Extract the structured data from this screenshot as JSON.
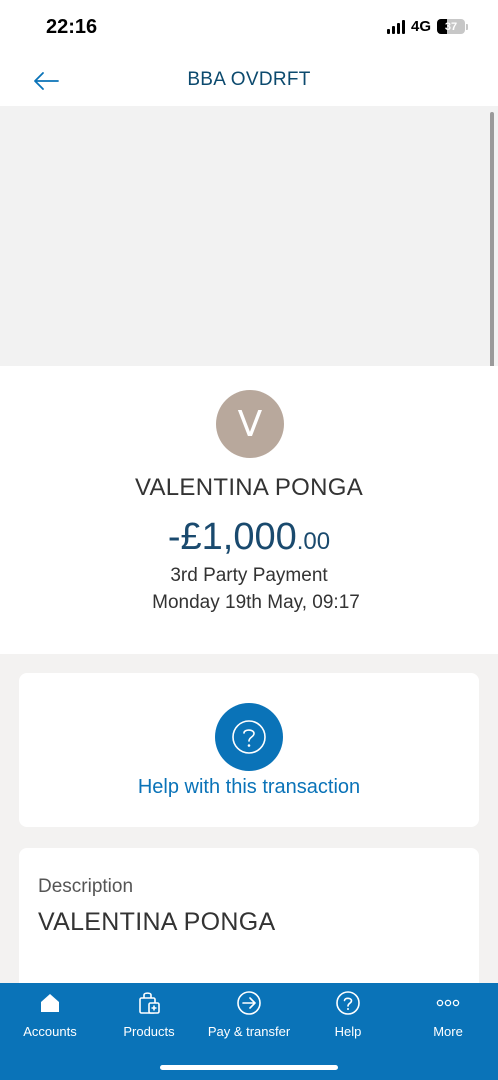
{
  "status_bar": {
    "time": "22:16",
    "network": "4G",
    "battery": "37",
    "battery_level": 0.37
  },
  "header": {
    "title": "BBA OVDRFT",
    "back_icon": "arrow-left-icon"
  },
  "transaction": {
    "avatar_initial": "V",
    "payee": "VALENTINA PONGA",
    "amount_main": "-£1,000",
    "amount_pence": ".00",
    "type": "3rd Party Payment",
    "date": "Monday 19th May, 09:17"
  },
  "help": {
    "icon": "question-circle-icon",
    "label": "Help with this transaction"
  },
  "description": {
    "label": "Description",
    "value": "VALENTINA PONGA"
  },
  "bottom_nav": {
    "items": [
      {
        "label": "Accounts",
        "icon": "home-icon"
      },
      {
        "label": "Products",
        "icon": "shopping-bag-icon"
      },
      {
        "label": "Pay & transfer",
        "icon": "arrow-circle-icon"
      },
      {
        "label": "Help",
        "icon": "question-circle-icon"
      },
      {
        "label": "More",
        "icon": "more-dots-icon"
      }
    ]
  },
  "colors": {
    "brand_blue": "#0a73b8",
    "amount_navy": "#1a4a6e",
    "avatar_bg": "#b8a89c",
    "page_bg": "#f3f2f1"
  }
}
